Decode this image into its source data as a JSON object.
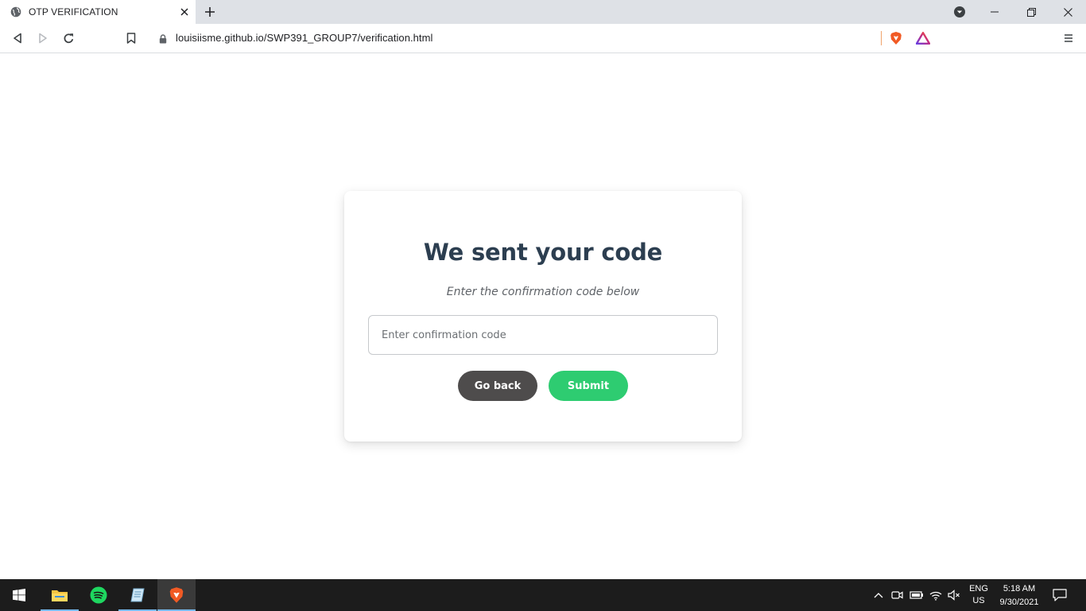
{
  "browser": {
    "tab_title": "OTP VERIFICATION",
    "url": "louisiisme.github.io/SWP391_GROUP7/verification.html"
  },
  "card": {
    "title": "We sent your code",
    "subtitle": "Enter the confirmation code below",
    "input_placeholder": "Enter confirmation code",
    "input_value": "",
    "go_back_label": "Go back",
    "submit_label": "Submit"
  },
  "colors": {
    "title": "#2c3e50",
    "go_back_button": "#4e4c4c",
    "submit_button": "#2ecc71",
    "taskbar": "#1c1c1c"
  },
  "taskbar": {
    "apps": [
      "file-explorer-icon",
      "spotify-icon",
      "notepad-icon",
      "brave-browser-icon"
    ],
    "language_line1": "ENG",
    "language_line2": "US",
    "time": "5:18 AM",
    "date": "9/30/2021"
  }
}
